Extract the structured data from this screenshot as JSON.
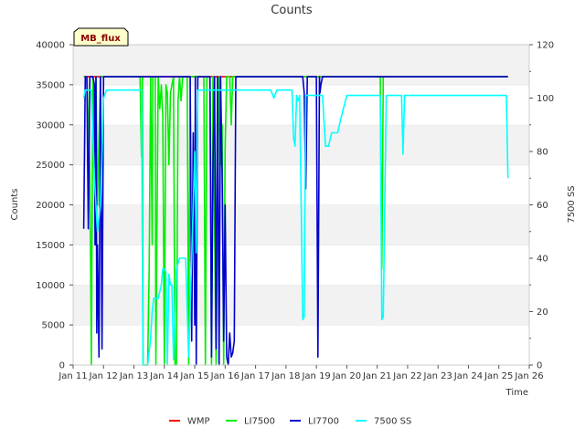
{
  "chart_data": {
    "type": "line",
    "title": "Counts",
    "xlabel": "Time",
    "ylabel": "Counts",
    "y2label": "7500 SS",
    "badge": "MB_flux",
    "ylim": [
      0,
      40000
    ],
    "y2lim": [
      0,
      120
    ],
    "xlim": [
      11,
      26
    ],
    "yticks": [
      0,
      5000,
      10000,
      15000,
      20000,
      25000,
      30000,
      35000,
      40000
    ],
    "y2ticks": [
      0,
      20,
      40,
      60,
      80,
      100,
      120
    ],
    "xticks": [
      11,
      12,
      13,
      14,
      15,
      16,
      17,
      18,
      19,
      20,
      21,
      22,
      23,
      24,
      25,
      26
    ],
    "xtick_labels": [
      "Jan 11",
      "Jan 12",
      "Jan 13",
      "Jan 14",
      "Jan 15",
      "Jan 16",
      "Jan 17",
      "Jan 18",
      "Jan 19",
      "Jan 20",
      "Jan 21",
      "Jan 22",
      "Jan 23",
      "Jan 24",
      "Jan 25",
      "Jan 26"
    ],
    "grid": "horizontal bands",
    "legend_position": "bottom",
    "series": [
      {
        "name": "WMP",
        "color": "#ff0000",
        "axis": "left",
        "x": [
          11.35,
          25.3
        ],
        "y": [
          36000,
          36000
        ]
      },
      {
        "name": "LI7500",
        "color": "#00ee00",
        "axis": "left",
        "x": [
          11.35,
          11.45,
          11.55,
          11.6,
          11.65,
          11.7,
          11.75,
          11.8,
          11.9,
          12.0,
          12.1,
          13.2,
          13.25,
          13.28,
          13.3,
          13.45,
          13.5,
          13.55,
          13.6,
          13.62,
          13.7,
          13.72,
          13.8,
          13.85,
          13.9,
          13.95,
          14.0,
          14.05,
          14.1,
          14.15,
          14.2,
          14.25,
          14.3,
          14.35,
          14.4,
          14.45,
          14.5,
          14.55,
          14.6,
          14.65,
          14.7,
          14.75,
          14.8,
          14.85,
          14.9,
          15.0,
          15.1,
          15.2,
          15.3,
          15.35,
          15.4,
          15.45,
          15.5,
          15.55,
          15.6,
          15.7,
          15.8,
          15.85,
          15.9,
          15.95,
          16.0,
          16.05,
          16.1,
          16.15,
          16.2,
          16.25,
          16.3,
          16.35,
          16.4,
          16.5,
          16.6,
          16.7,
          16.8,
          21.0,
          21.1,
          21.15,
          21.2,
          21.25,
          21.3,
          25.3
        ],
        "y": [
          36000,
          36000,
          24000,
          0,
          36000,
          24000,
          36000,
          20000,
          36000,
          36000,
          36000,
          36000,
          26000,
          36000,
          0,
          0,
          12000,
          36000,
          15000,
          36000,
          36000,
          0,
          36000,
          32000,
          35000,
          31000,
          0,
          35000,
          34000,
          25000,
          34000,
          35000,
          36000,
          0,
          0,
          33000,
          36000,
          33000,
          36000,
          36000,
          36000,
          36000,
          0,
          36000,
          36000,
          36000,
          36000,
          36000,
          36000,
          0,
          36000,
          36000,
          36000,
          0,
          36000,
          0,
          36000,
          25000,
          30000,
          0,
          27000,
          36000,
          36000,
          36000,
          30000,
          36000,
          36000,
          36000,
          36000,
          36000,
          36000,
          36000,
          36000,
          36000,
          36000,
          12000,
          36000,
          36000,
          36000,
          36000
        ]
      },
      {
        "name": "LI7700",
        "color": "#0000cc",
        "axis": "left",
        "x": [
          11.35,
          11.4,
          11.45,
          11.5,
          11.55,
          11.6,
          11.65,
          11.7,
          11.72,
          11.75,
          11.78,
          11.8,
          11.85,
          11.9,
          11.95,
          12.0,
          12.05,
          14.85,
          14.9,
          14.95,
          15.0,
          15.02,
          15.05,
          15.1,
          15.15,
          15.2,
          15.3,
          15.5,
          15.55,
          15.6,
          15.65,
          15.7,
          15.75,
          15.8,
          15.85,
          15.9,
          15.95,
          16.0,
          16.05,
          16.1,
          16.15,
          16.2,
          16.25,
          16.3,
          16.35,
          16.4,
          16.45,
          16.5,
          16.6,
          18.55,
          18.6,
          18.65,
          18.7,
          18.75,
          18.8,
          19.0,
          19.05,
          19.1,
          19.12,
          19.15,
          19.2,
          19.25,
          19.3,
          25.3
        ],
        "y": [
          17000,
          36000,
          36000,
          17000,
          36000,
          36000,
          36000,
          35000,
          15000,
          36000,
          4000,
          15000,
          1000,
          36000,
          2000,
          36000,
          36000,
          36000,
          3000,
          29000,
          5000,
          36000,
          0,
          36000,
          36000,
          36000,
          36000,
          36000,
          1000,
          25000,
          36000,
          2000,
          36000,
          0,
          36000,
          24000,
          3000,
          20000,
          1000,
          0,
          4000,
          1000,
          1500,
          3000,
          36000,
          36000,
          36000,
          36000,
          36000,
          36000,
          34000,
          22000,
          36000,
          36000,
          36000,
          36000,
          1000,
          36000,
          34000,
          35000,
          36000,
          36000,
          36000,
          36000
        ]
      },
      {
        "name": "7500 SS",
        "color": "#00ffff",
        "axis": "right",
        "x": [
          11.35,
          11.4,
          11.5,
          11.6,
          11.7,
          11.8,
          11.9,
          12.0,
          12.1,
          12.3,
          13.2,
          13.25,
          13.3,
          13.45,
          13.55,
          13.6,
          13.65,
          13.7,
          13.8,
          13.9,
          13.95,
          14.0,
          14.05,
          14.1,
          14.15,
          14.2,
          14.25,
          14.3,
          14.4,
          14.5,
          14.6,
          14.7,
          14.8,
          14.9,
          15.0,
          15.05,
          15.1,
          15.2,
          15.3,
          15.4,
          15.5,
          15.6,
          15.7,
          15.8,
          15.9,
          16.0,
          16.1,
          16.2,
          16.3,
          16.4,
          16.5,
          16.6,
          16.8,
          17.0,
          17.5,
          17.6,
          17.7,
          18.0,
          18.2,
          18.25,
          18.3,
          18.35,
          18.4,
          18.45,
          18.5,
          18.55,
          18.6,
          18.65,
          18.7,
          18.8,
          18.9,
          19.0,
          19.1,
          19.2,
          19.3,
          19.4,
          19.5,
          19.6,
          19.7,
          19.8,
          20.0,
          21.0,
          21.1,
          21.15,
          21.2,
          21.3,
          21.5,
          21.8,
          21.85,
          21.9,
          22.0,
          23.0,
          23.5,
          23.6,
          24.0,
          24.1,
          24.2,
          24.3,
          24.4,
          24.5,
          24.6,
          24.7,
          24.8,
          25.0,
          25.1,
          25.2,
          25.25,
          25.3
        ],
        "y": [
          100,
          103,
          103,
          103,
          70,
          50,
          60,
          100,
          103,
          103,
          103,
          103,
          0,
          0,
          10,
          20,
          25,
          25,
          25,
          30,
          36,
          36,
          35,
          0,
          34,
          30,
          30,
          2,
          36,
          40,
          40,
          40,
          3,
          40,
          80,
          42,
          103,
          103,
          103,
          103,
          103,
          103,
          103,
          103,
          103,
          103,
          103,
          103,
          103,
          103,
          103,
          103,
          103,
          103,
          103,
          100,
          103,
          103,
          103,
          85,
          82,
          101,
          99,
          101,
          60,
          17,
          18,
          101,
          101,
          101,
          101,
          101,
          101,
          101,
          82,
          82,
          87,
          87,
          87,
          92,
          101,
          101,
          101,
          17,
          18,
          101,
          101,
          101,
          79,
          101,
          101,
          101,
          101,
          101,
          101,
          101,
          101,
          101,
          101,
          101,
          101,
          101,
          101,
          101,
          101,
          101,
          101,
          70
        ]
      }
    ]
  }
}
